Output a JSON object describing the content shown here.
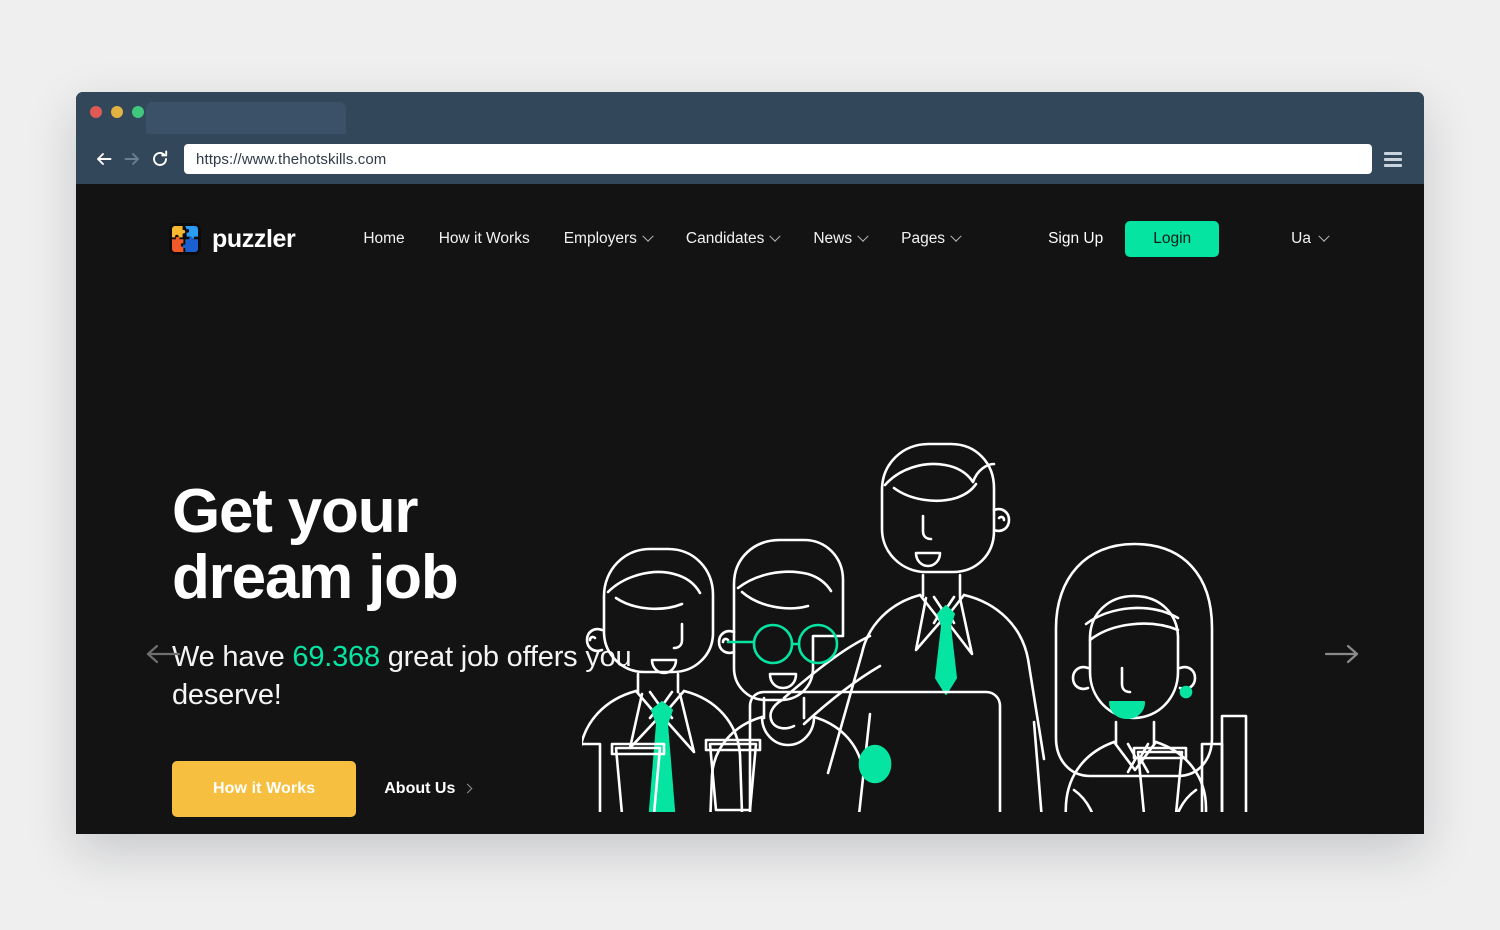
{
  "browser": {
    "url": "https://www.thehotskills.com",
    "back_icon": "back-arrow-icon",
    "forward_icon": "forward-arrow-icon",
    "reload_icon": "reload-icon",
    "menu_icon": "hamburger-menu-icon",
    "traffic_lights": [
      "close",
      "minimize",
      "maximize"
    ]
  },
  "site": {
    "logo": {
      "text": "puzzler",
      "mark": "puzzle-piece-icon",
      "colors": {
        "yellow": "#f7b731",
        "orange": "#f05a28",
        "blue_light": "#2a9cf5",
        "blue_dark": "#1c5fd0"
      }
    },
    "nav": [
      {
        "label": "Home",
        "has_dropdown": false
      },
      {
        "label": "How it Works",
        "has_dropdown": false
      },
      {
        "label": "Employers",
        "has_dropdown": true
      },
      {
        "label": "Candidates",
        "has_dropdown": true
      },
      {
        "label": "News",
        "has_dropdown": true
      },
      {
        "label": "Pages",
        "has_dropdown": true
      }
    ],
    "actions": {
      "signup_label": "Sign Up",
      "login_label": "Login",
      "language": "Ua"
    }
  },
  "hero": {
    "title_line1": "Get your",
    "title_line2": "dream job",
    "subtitle_before": "We have ",
    "count": "69.368",
    "subtitle_after": " great job offers you deserve!",
    "primary_button": "How it Works",
    "secondary_link": "About Us",
    "prev_icon": "arrow-left-icon",
    "next_icon": "arrow-right-icon",
    "illustration": "four-people-at-laptop-line-art"
  },
  "colors": {
    "page_bg": "#efefef",
    "chrome": "#33475b",
    "site_bg": "#131313",
    "accent_green": "#06e4a2",
    "accent_yellow": "#f7bf3f",
    "text_light": "#ffffff"
  }
}
